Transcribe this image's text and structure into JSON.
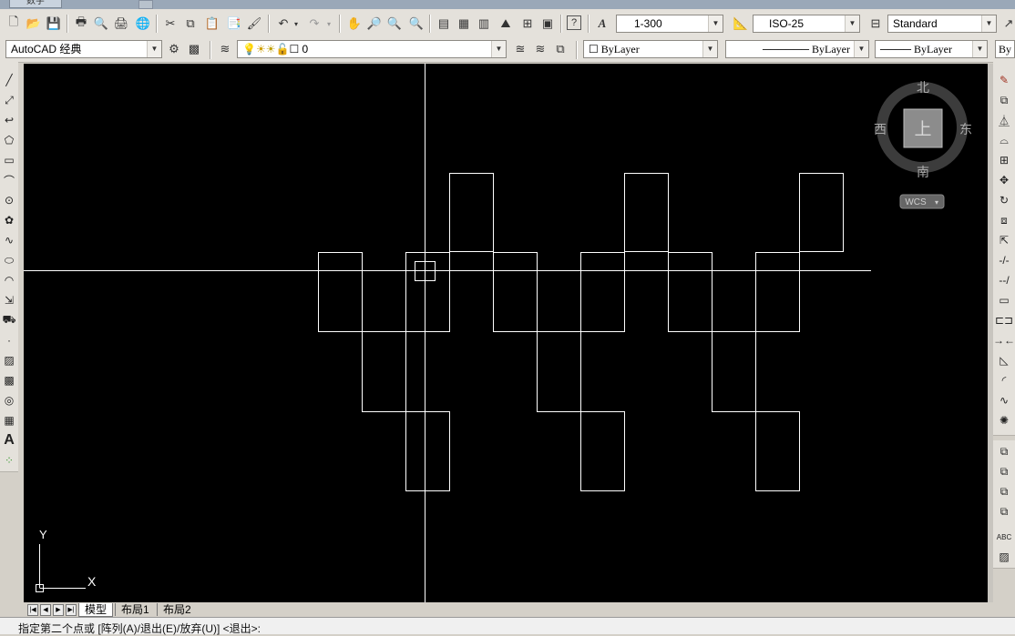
{
  "window": {
    "doc_tab": "数字"
  },
  "toolbar1": {
    "scale_combo": "1-300",
    "dimstyle_combo": "ISO-25",
    "textstyle_combo": "Standard"
  },
  "toolbar2": {
    "workspace_combo": "AutoCAD 经典",
    "layer_combo": "0",
    "color_combo": "ByLayer",
    "linetype_combo": "ByLayer",
    "lineweight_combo": "ByLayer",
    "plotstyle_combo": "By"
  },
  "viewcube": {
    "north": "北",
    "south": "南",
    "east": "东",
    "west": "西",
    "top_face": "上",
    "wcs": "WCS"
  },
  "ucs": {
    "x": "X",
    "y": "Y"
  },
  "tabs": [
    "模型",
    "布局1",
    "布局2"
  ],
  "active_tab": "模型",
  "command_line": "指定第二个点或 [阵列(A)/退出(E)/放弃(U)] <退出>:",
  "colors": {
    "canvas": "#000000",
    "geometry": "#ffffff",
    "toolbar": "#e4e1db"
  }
}
